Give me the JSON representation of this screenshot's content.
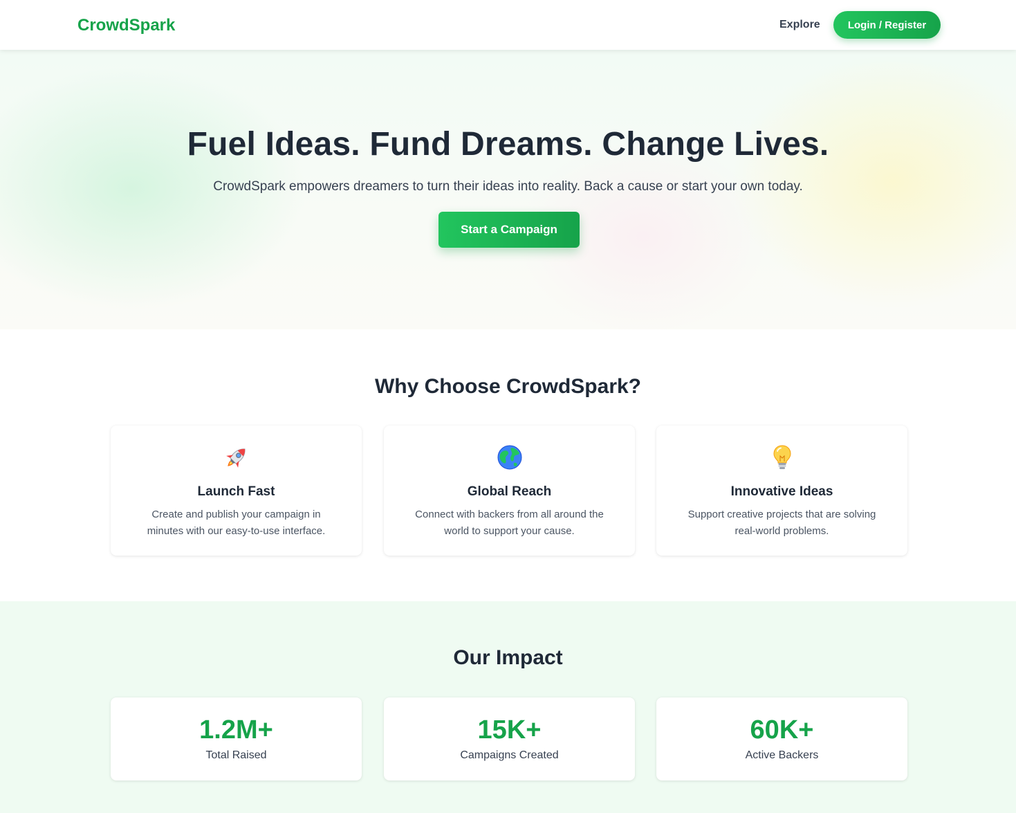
{
  "header": {
    "brand": "CrowdSpark",
    "nav": {
      "explore_label": "Explore",
      "login_label": "Login / Register"
    }
  },
  "hero": {
    "title": "Fuel Ideas. Fund Dreams. Change Lives.",
    "subtitle": "CrowdSpark empowers dreamers to turn their ideas into reality. Back a cause or start your own today.",
    "cta_label": "Start a Campaign"
  },
  "features": {
    "title": "Why Choose CrowdSpark?",
    "items": [
      {
        "icon": "rocket-icon",
        "title": "Launch Fast",
        "description": "Create and publish your campaign in minutes with our easy-to-use interface."
      },
      {
        "icon": "globe-icon",
        "title": "Global Reach",
        "description": "Connect with backers from all around the world to support your cause."
      },
      {
        "icon": "lightbulb-icon",
        "title": "Innovative Ideas",
        "description": "Support creative projects that are solving real-world problems."
      }
    ]
  },
  "impact": {
    "title": "Our Impact",
    "stats": [
      {
        "value": "1.2M+",
        "label": "Total Raised"
      },
      {
        "value": "15K+",
        "label": "Campaigns Created"
      },
      {
        "value": "60K+",
        "label": "Active Backers"
      }
    ]
  },
  "colors": {
    "brand_green": "#16a34a",
    "button_gradient_start": "#22c55e",
    "button_gradient_end": "#16a34a",
    "heading_text": "#1f2937",
    "impact_background": "#effbf2"
  }
}
